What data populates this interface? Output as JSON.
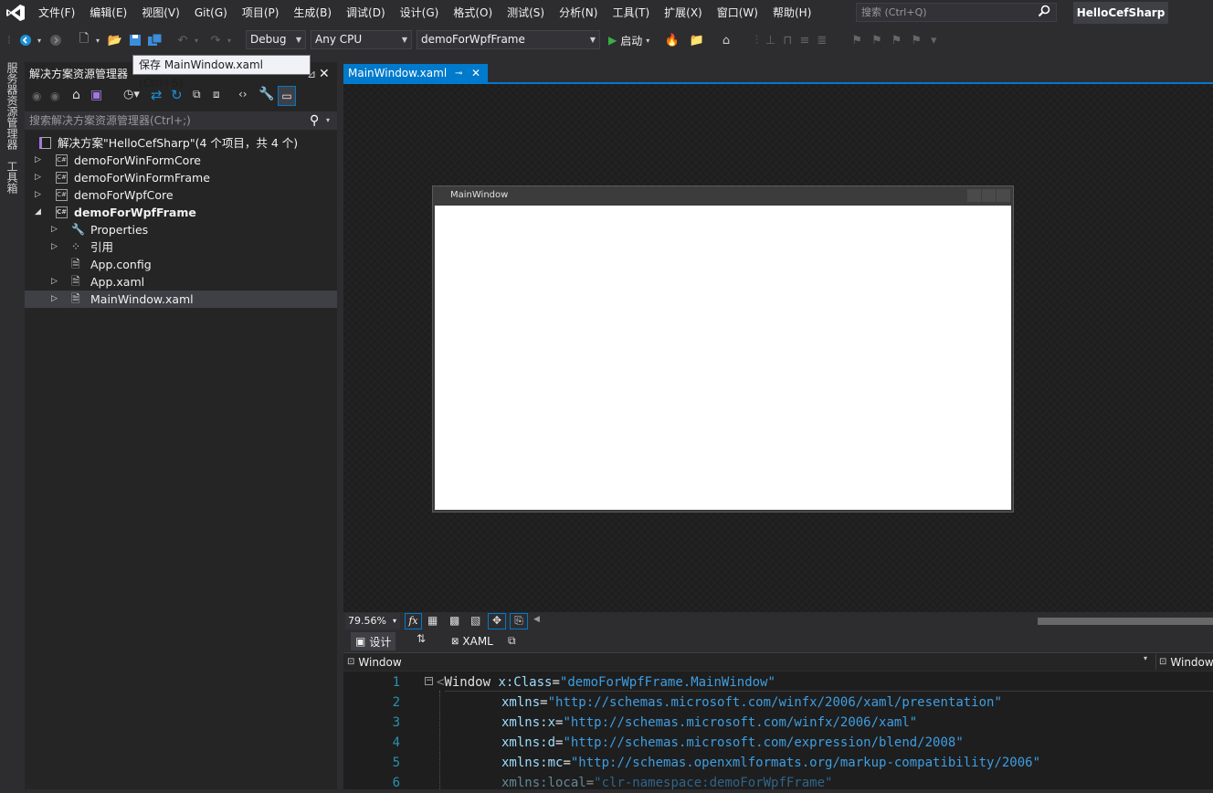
{
  "menu": [
    "文件(F)",
    "编辑(E)",
    "视图(V)",
    "Git(G)",
    "项目(P)",
    "生成(B)",
    "调试(D)",
    "设计(G)",
    "格式(O)",
    "测试(S)",
    "分析(N)",
    "工具(T)",
    "扩展(X)",
    "窗口(W)",
    "帮助(H)"
  ],
  "search": {
    "placeholder": "搜索 (Ctrl+Q)"
  },
  "solution_name": "HelloCefSharp",
  "toolbar": {
    "config": "Debug",
    "platform": "Any CPU",
    "startup_project": "demoForWpfFrame",
    "run_label": "启动",
    "tooltip": "保存 MainWindow.xaml (Ctrl+S)"
  },
  "side_tabs": [
    "服务器资源管理器",
    "工具箱"
  ],
  "solution_explorer": {
    "title": "解决方案资源管理器",
    "search_placeholder": "搜索解决方案资源管理器(Ctrl+;)",
    "solution_label": "解决方案\"HelloCefSharp\"(4 个项目，共 4 个)",
    "projects": [
      "demoForWinFormCore",
      "demoForWinFormFrame",
      "demoForWpfCore",
      "demoForWpfFrame"
    ],
    "children": [
      "Properties",
      "引用",
      "App.config",
      "App.xaml",
      "MainWindow.xaml"
    ]
  },
  "editor": {
    "tab_title": "MainWindow.xaml",
    "window_title": "MainWindow",
    "zoom": "79.56%",
    "design_tab": "设计",
    "xaml_tab": "XAML",
    "nav_left": "Window",
    "nav_right": "Window",
    "fx": "fx",
    "line_numbers": [
      "1",
      "2",
      "3",
      "4",
      "5",
      "6"
    ],
    "lines": [
      {
        "tag": "Window",
        "attr": "x:Class",
        "val": "\"demoForWpfFrame.MainWindow\""
      },
      {
        "attr": "xmlns",
        "val": "\"http://schemas.microsoft.com/winfx/2006/xaml/presentation\""
      },
      {
        "attr": "xmlns:x",
        "val": "\"http://schemas.microsoft.com/winfx/2006/xaml\""
      },
      {
        "attr": "xmlns:d",
        "val": "\"http://schemas.microsoft.com/expression/blend/2008\""
      },
      {
        "attr": "xmlns:mc",
        "val": "\"http://schemas.openxmlformats.org/markup-compatibility/2006\""
      },
      {
        "attr": "xmlns:local",
        "val": "\"clr-namespace:demoForWpfFrame\""
      }
    ]
  }
}
